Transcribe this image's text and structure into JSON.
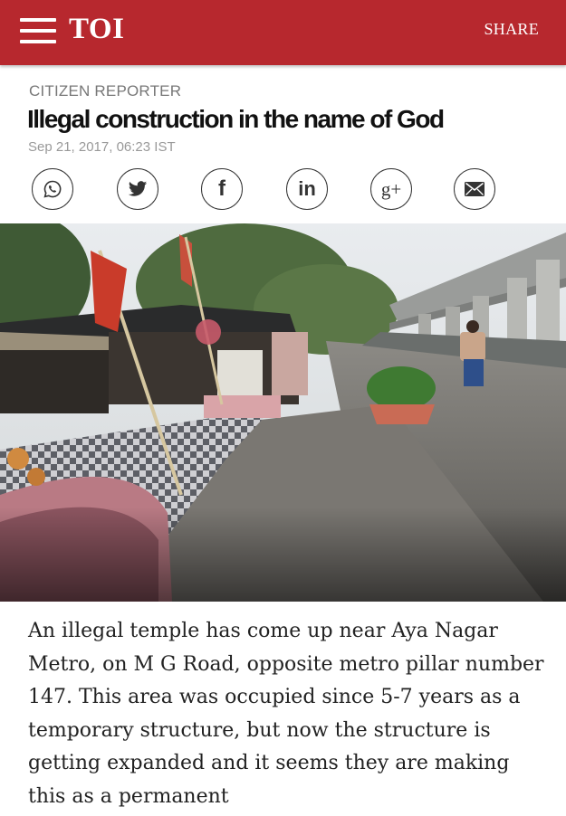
{
  "header": {
    "logo": "TOI",
    "share_label": "SHARE",
    "background_color": "#b7282e"
  },
  "article": {
    "section": "CITIZEN REPORTER",
    "title": "Illegal construction in the name of God",
    "dateline": "Sep 21, 2017, 06:23 IST",
    "body": "An illegal temple has come up near Aya Nagar Metro, on M G Road, opposite metro pillar number 147. This area was occupied since 5-7 years as a temporary structure, but now the structure is getting expanded and it seems they are making this as a permanent"
  },
  "share_buttons": [
    {
      "icon": "whatsapp-icon",
      "label": "WhatsApp"
    },
    {
      "icon": "twitter-icon",
      "label": "Twitter"
    },
    {
      "icon": "facebook-icon",
      "label": "f"
    },
    {
      "icon": "linkedin-icon",
      "label": "in"
    },
    {
      "icon": "google-plus-icon",
      "label": "g+"
    },
    {
      "icon": "email-icon",
      "label": "Email"
    }
  ]
}
